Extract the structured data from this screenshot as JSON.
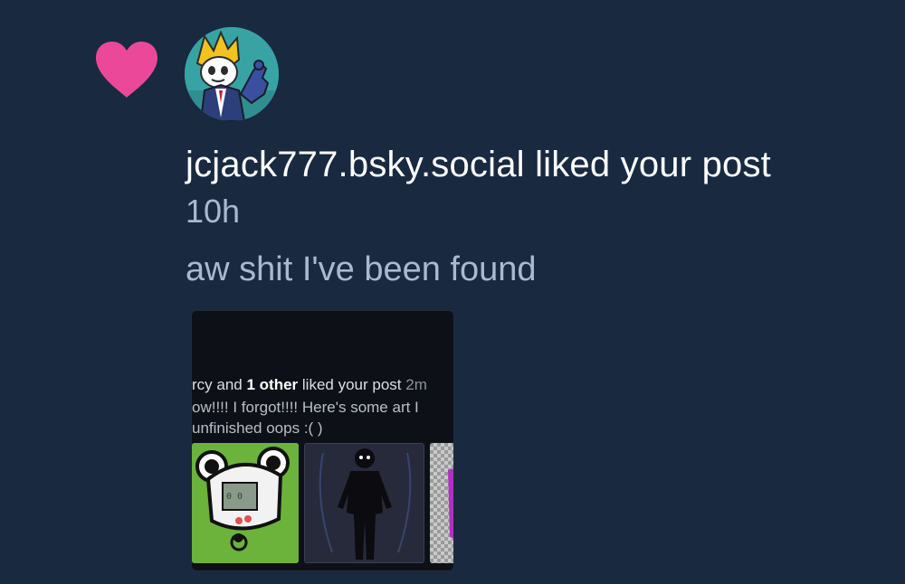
{
  "notification": {
    "icon": "heart-icon",
    "heart_color": "#ec4899",
    "avatar": "user-avatar",
    "actor": "jcjack777.bsky.social",
    "action": "liked your post",
    "time": "10h",
    "post_text": "aw shit I've been found"
  },
  "embed_screenshot": {
    "line1_prefix": "rcy and ",
    "line1_bold": "1 other",
    "line1_suffix": " liked your post ",
    "line1_time": "2m",
    "line2": "ow!!!! I forgot!!!! Here's some art I",
    "line3": "unfinished oops :( )"
  }
}
